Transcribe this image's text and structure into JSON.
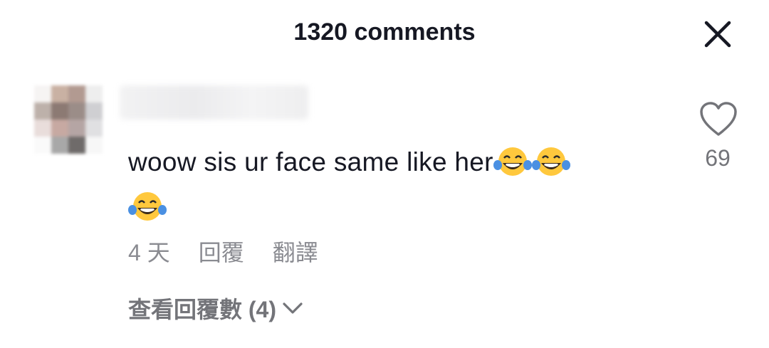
{
  "header": {
    "title": "1320 comments",
    "close_icon": "close-icon"
  },
  "comment": {
    "username": "",
    "text": "woow sis ur face same like her",
    "emojis": [
      "face-with-tears-of-joy",
      "face-with-tears-of-joy",
      "face-with-tears-of-joy"
    ],
    "time": "4 天",
    "reply_label": "回覆",
    "translate_label": "翻譯",
    "like_count": "69",
    "view_replies_label": "查看回覆數 (4)"
  },
  "colors": {
    "text": "#161823",
    "secondary": "#8a8b91",
    "emoji_face": "#FFC83D",
    "tears": "#4A90E2"
  }
}
